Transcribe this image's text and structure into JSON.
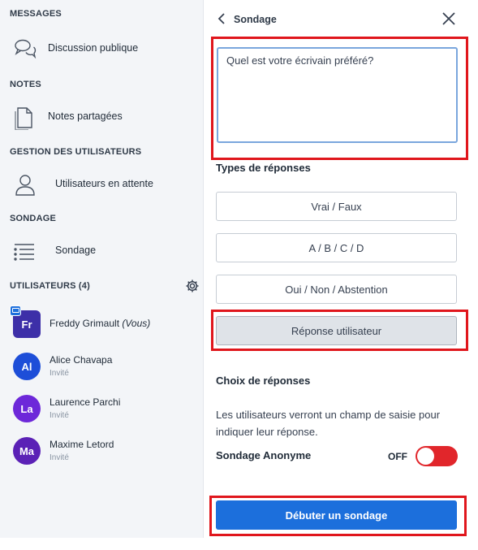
{
  "sidebar": {
    "sections": {
      "messages": "MESSAGES",
      "notes": "NOTES",
      "user_management": "GESTION DES UTILISATEURS",
      "poll": "SONDAGE",
      "users": "UTILISATEURS (4)"
    },
    "items": {
      "public_chat": {
        "label": "Discussion publique",
        "icon": "chat-bubbles-icon"
      },
      "shared_notes": {
        "label": "Notes partagées",
        "icon": "document-icon"
      },
      "waiting_users": {
        "label": "Utilisateurs en attente",
        "icon": "user-icon"
      },
      "poll": {
        "label": "Sondage",
        "icon": "list-icon"
      }
    },
    "users": [
      {
        "initials": "Fr",
        "name": "Freddy Grimault",
        "suffix": "(Vous)",
        "role": "",
        "color": "#3d2fa8",
        "presenter": true
      },
      {
        "initials": "Al",
        "name": "Alice Chavapa",
        "role": "Invité",
        "color": "#1d4ed8"
      },
      {
        "initials": "La",
        "name": "Laurence Parchi",
        "role": "Invité",
        "color": "#6d28d9"
      },
      {
        "initials": "Ma",
        "name": "Maxime Letord",
        "role": "Invité",
        "color": "#5b21b6"
      }
    ]
  },
  "panel": {
    "title": "Sondage",
    "question_value": "Quel est votre écrivain préféré?",
    "response_types_title": "Types de réponses",
    "options": [
      "Vrai / Faux",
      "A / B / C / D",
      "Oui / Non / Abstention",
      "Réponse utilisateur"
    ],
    "active_option": "Réponse utilisateur",
    "choices_title": "Choix de réponses",
    "choices_description": "Les utilisateurs verront un champ de saisie pour indiquer leur réponse.",
    "anonymous_label": "Sondage Anonyme",
    "anonymous_state": "OFF",
    "start_button": "Débuter un sondage"
  },
  "colors": {
    "accent": "#1c6fdc",
    "toggle_off": "#e1262b",
    "highlight": "#e0161c"
  }
}
